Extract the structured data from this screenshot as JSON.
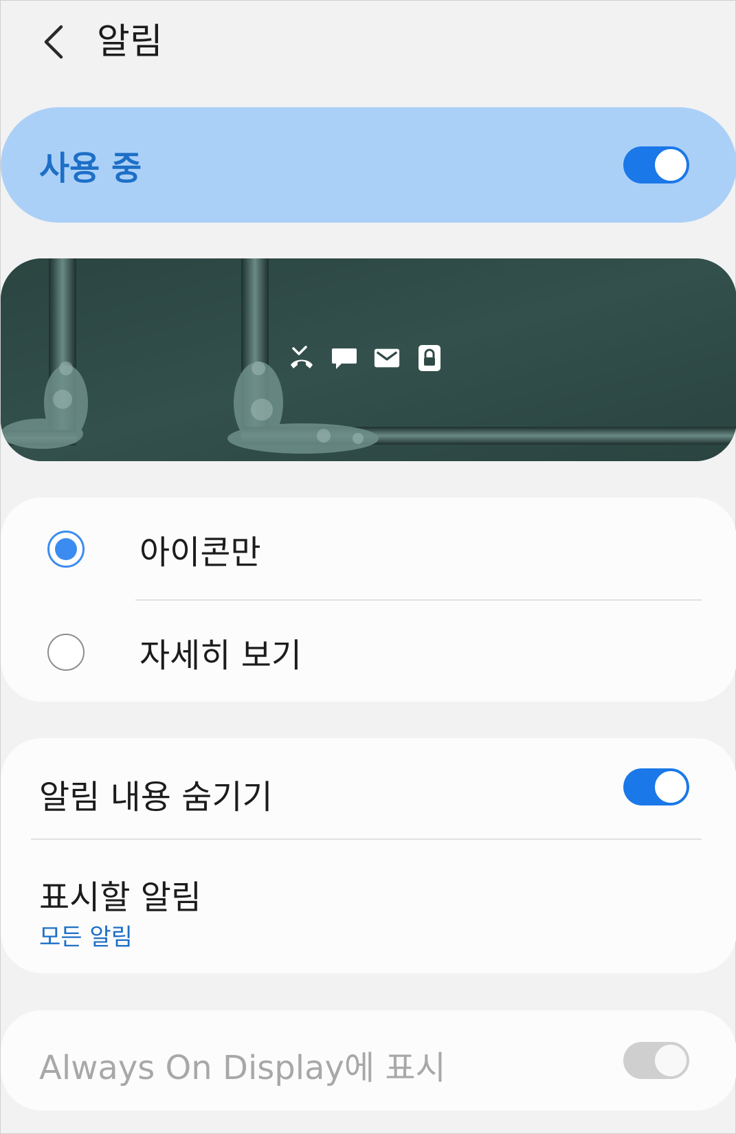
{
  "header": {
    "title": "알림",
    "back_icon": "chevron-left-icon"
  },
  "master": {
    "label": "사용 중",
    "toggle_on": true
  },
  "preview": {
    "icons": [
      "missed-call-icon",
      "message-icon",
      "email-icon",
      "lock-icon"
    ]
  },
  "style_options": [
    {
      "label": "아이콘만",
      "selected": true
    },
    {
      "label": "자세히 보기",
      "selected": false
    }
  ],
  "settings": {
    "hide_content": {
      "label": "알림 내용 숨기기",
      "toggle_on": true
    },
    "show_notifications": {
      "label": "표시할 알림",
      "value": "모든 알림"
    }
  },
  "aod": {
    "label": "Always On Display에 표시",
    "toggle_on": true,
    "enabled": false
  },
  "colors": {
    "accent": "#1b78e8",
    "highlight_card": "#abd0f7",
    "accent_text": "#1d6fc7"
  }
}
